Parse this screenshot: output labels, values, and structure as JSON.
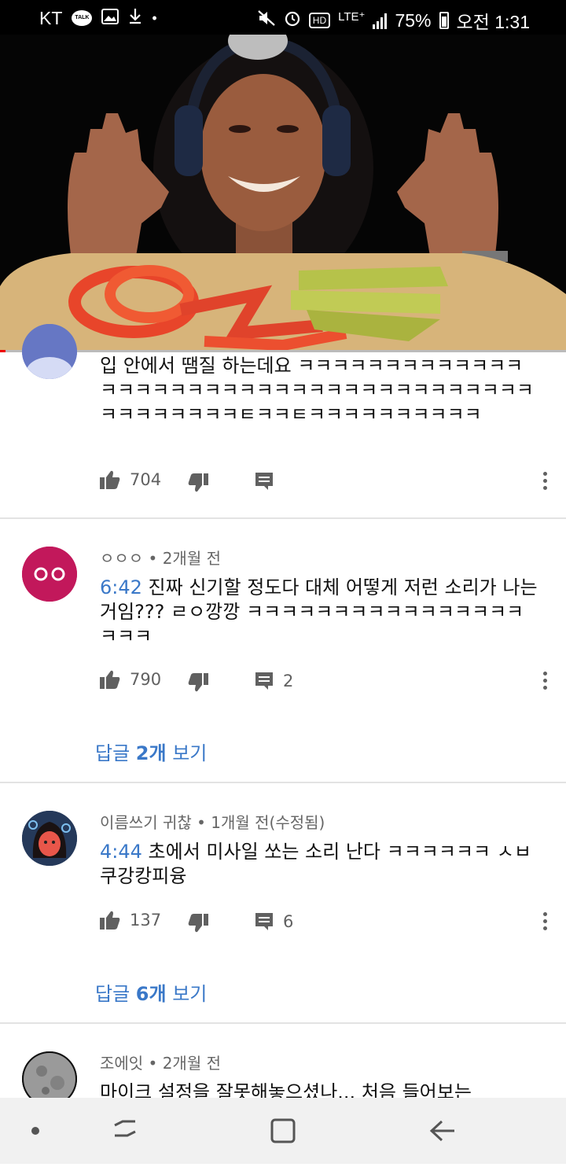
{
  "status_bar": {
    "carrier": "KT",
    "lte": "LTE⁺",
    "hd": "HD",
    "battery": "75%",
    "time": "오전 1:31",
    "icons": [
      "talk-icon",
      "gallery-icon",
      "download-icon",
      "mute-icon",
      "alarm-icon",
      "signal-icon",
      "battery-icon"
    ]
  },
  "video": {
    "progress": 0.01
  },
  "comments": [
    {
      "meta": "",
      "timestamp": "",
      "text": "입 안에서 땜질 하는데요 ㅋㅋㅋㅋㅋㅋㅋㅋㅋㅋㅋㅋㅋㅋㅋㅋㅋㅋㅋㅋㅋㅋㅋㅋㅋㅋㅋㅋㅋㅋㅋㅋㅋㅋㅋㅋㅋㅋㅋㅋㅋㅋㅋㅋㅋㅋㅌㅋㅋㅌㅋㅋㅋㅋㅋㅋㅋㅋㅋㅋ",
      "likes": "704",
      "reply_count": "",
      "view_replies_prefix": "",
      "view_replies_count": "",
      "view_replies_suffix": ""
    },
    {
      "meta": "ㅇㅇㅇ • 2개월 전",
      "timestamp": "6:42",
      "text": " 진짜 신기할 정도다 대체 어떻게 저런 소리가 나는거임??? ㄹㅇ깡깡 ㅋㅋㅋㅋㅋㅋㅋㅋㅋㅋㅋㅋㅋㅋㅋㅋㅋㅋㅋ",
      "likes": "790",
      "reply_count": "2",
      "view_replies_prefix": "답글 ",
      "view_replies_count": "2개",
      "view_replies_suffix": " 보기"
    },
    {
      "meta": "이름쓰기 귀찮 • 1개월 전(수정됨)",
      "timestamp": "4:44",
      "text": " 초에서 미사일 쏘는 소리 난다 ㅋㅋㅋㅋㅋㅋ ㅅㅂ 쿠강캉피융",
      "likes": "137",
      "reply_count": "6",
      "view_replies_prefix": "답글 ",
      "view_replies_count": "6개",
      "view_replies_suffix": " 보기"
    },
    {
      "meta": "조에잇 • 2개월 전",
      "timestamp": "",
      "text": "마이크 설정을 잘못해놓으셨나... 처음 들어보는",
      "likes": "",
      "reply_count": "",
      "view_replies_prefix": "",
      "view_replies_count": "",
      "view_replies_suffix": ""
    }
  ],
  "colors": {
    "link": "#3a78c8",
    "progress": "#e00000",
    "avatar2": "#c2185b"
  }
}
